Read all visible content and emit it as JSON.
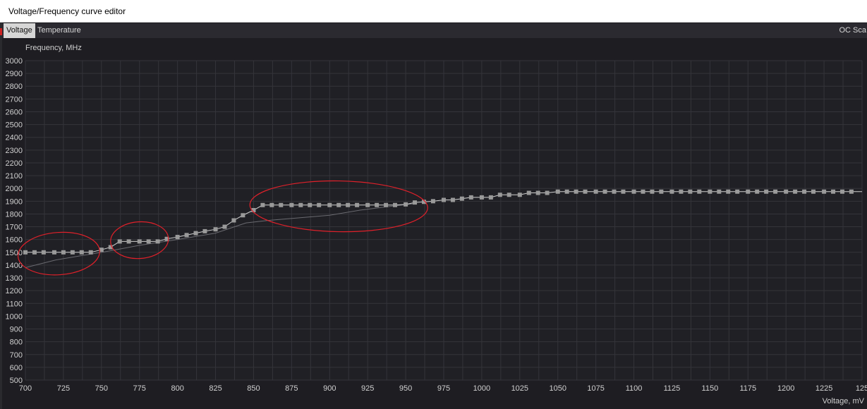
{
  "window": {
    "title": "Voltage/Frequency curve editor"
  },
  "tabs": {
    "voltage": "Voltage",
    "temperature": "Temperature",
    "oc_scan": "OC Sca"
  },
  "colors": {
    "background": "#1e1d22",
    "plot_bg": "#202025",
    "grid": "#34343a",
    "curve": "#cfcfcf",
    "point": "#9a9a9a",
    "annotation": "#e0202a",
    "tab_active_bg": "#d6d6d6"
  },
  "chart_data": {
    "type": "line",
    "ylabel": "Frequency, MHz",
    "xlabel": "Voltage, mV",
    "xlim": [
      700,
      1250
    ],
    "ylim": [
      500,
      3000
    ],
    "x_ticks": [
      "700",
      "725",
      "750",
      "775",
      "800",
      "825",
      "850",
      "875",
      "900",
      "925",
      "950",
      "975",
      "1000",
      "1025",
      "1050",
      "1075",
      "1100",
      "1125",
      "1150",
      "1175",
      "1200",
      "1225",
      "125"
    ],
    "y_ticks": [
      "3000",
      "2900",
      "2800",
      "2700",
      "2600",
      "2500",
      "2400",
      "2300",
      "2200",
      "2100",
      "2000",
      "1900",
      "1800",
      "1700",
      "1600",
      "1500",
      "1400",
      "1300",
      "1200",
      "1100",
      "1000",
      "900",
      "800",
      "700",
      "600",
      "500"
    ],
    "grid": true,
    "series": [
      {
        "points": [
          [
            700,
            1500
          ],
          [
            706,
            1500
          ],
          [
            712,
            1500
          ],
          [
            719,
            1500
          ],
          [
            725,
            1500
          ],
          [
            731,
            1500
          ],
          [
            737,
            1500
          ],
          [
            743,
            1500
          ],
          [
            750,
            1520
          ],
          [
            756,
            1540
          ],
          [
            762,
            1585
          ],
          [
            768,
            1585
          ],
          [
            775,
            1585
          ],
          [
            781,
            1585
          ],
          [
            787,
            1585
          ],
          [
            793,
            1605
          ],
          [
            800,
            1620
          ],
          [
            806,
            1635
          ],
          [
            812,
            1650
          ],
          [
            818,
            1665
          ],
          [
            825,
            1680
          ],
          [
            831,
            1700
          ],
          [
            837,
            1750
          ],
          [
            843,
            1790
          ],
          [
            850,
            1830
          ],
          [
            856,
            1870
          ],
          [
            862,
            1870
          ],
          [
            868,
            1870
          ],
          [
            875,
            1870
          ],
          [
            881,
            1870
          ],
          [
            887,
            1870
          ],
          [
            893,
            1870
          ],
          [
            900,
            1870
          ],
          [
            906,
            1870
          ],
          [
            912,
            1870
          ],
          [
            918,
            1870
          ],
          [
            925,
            1870
          ],
          [
            931,
            1870
          ],
          [
            937,
            1870
          ],
          [
            943,
            1870
          ],
          [
            950,
            1875
          ],
          [
            956,
            1890
          ],
          [
            962,
            1895
          ],
          [
            968,
            1900
          ],
          [
            975,
            1910
          ],
          [
            981,
            1910
          ],
          [
            987,
            1920
          ],
          [
            993,
            1930
          ],
          [
            1000,
            1930
          ],
          [
            1006,
            1930
          ],
          [
            1012,
            1950
          ],
          [
            1018,
            1950
          ],
          [
            1025,
            1950
          ],
          [
            1031,
            1965
          ],
          [
            1037,
            1965
          ],
          [
            1043,
            1965
          ],
          [
            1050,
            1975
          ],
          [
            1056,
            1975
          ],
          [
            1062,
            1975
          ],
          [
            1068,
            1975
          ],
          [
            1075,
            1975
          ],
          [
            1081,
            1975
          ],
          [
            1087,
            1975
          ],
          [
            1093,
            1975
          ],
          [
            1100,
            1975
          ],
          [
            1106,
            1975
          ],
          [
            1112,
            1975
          ],
          [
            1118,
            1975
          ],
          [
            1125,
            1975
          ],
          [
            1131,
            1975
          ],
          [
            1137,
            1975
          ],
          [
            1143,
            1975
          ],
          [
            1150,
            1975
          ],
          [
            1156,
            1975
          ],
          [
            1162,
            1975
          ],
          [
            1168,
            1975
          ],
          [
            1175,
            1975
          ],
          [
            1181,
            1975
          ],
          [
            1187,
            1975
          ],
          [
            1193,
            1975
          ],
          [
            1200,
            1975
          ],
          [
            1206,
            1975
          ],
          [
            1212,
            1975
          ],
          [
            1218,
            1975
          ],
          [
            1225,
            1975
          ],
          [
            1231,
            1975
          ],
          [
            1237,
            1975
          ],
          [
            1243,
            1975
          ]
        ]
      },
      {
        "style": "thin-dim",
        "points": [
          [
            700,
            1380
          ],
          [
            720,
            1440
          ],
          [
            740,
            1480
          ],
          [
            755,
            1510
          ],
          [
            775,
            1555
          ],
          [
            800,
            1600
          ],
          [
            825,
            1650
          ],
          [
            845,
            1730
          ],
          [
            860,
            1750
          ],
          [
            880,
            1770
          ],
          [
            900,
            1790
          ],
          [
            920,
            1830
          ],
          [
            940,
            1860
          ],
          [
            955,
            1880
          ]
        ]
      }
    ],
    "annotations": [
      {
        "shape": "circle",
        "around_voltage": [
          700,
          745
        ]
      },
      {
        "shape": "circle",
        "around_voltage": [
          755,
          795
        ]
      },
      {
        "shape": "circle",
        "around_voltage": [
          850,
          965
        ]
      }
    ]
  }
}
